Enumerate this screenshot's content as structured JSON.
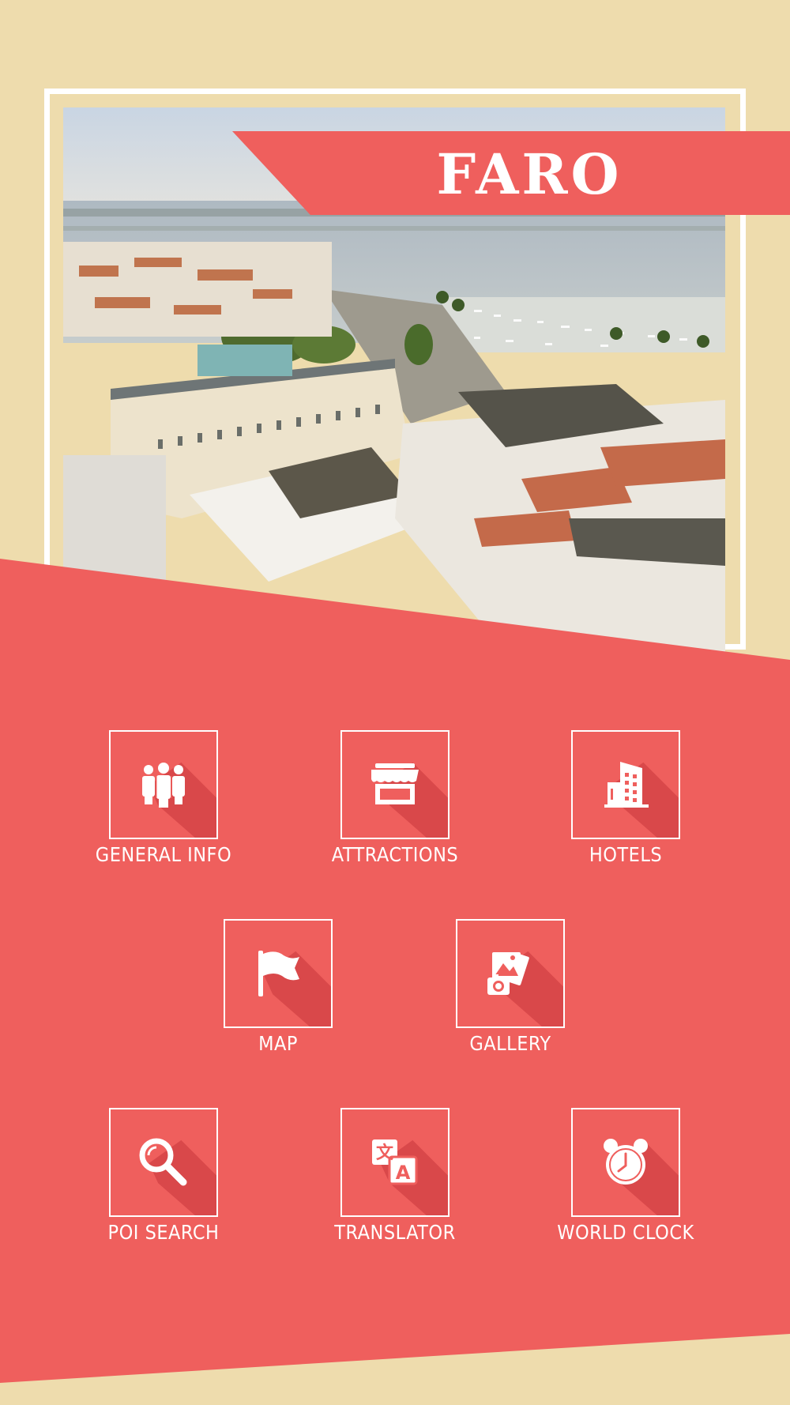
{
  "app": {
    "title": "FARO"
  },
  "colors": {
    "background": "#EEDCAD",
    "accent": "#EF5F5D",
    "accent_dark": "#D9484A",
    "text": "#FFFFFF"
  },
  "hero": {
    "image_icon": "city-harbor-photo"
  },
  "menu": [
    {
      "label": "GENERAL INFO",
      "icon": "people-icon"
    },
    {
      "label": "ATTRACTIONS",
      "icon": "store-icon"
    },
    {
      "label": "HOTELS",
      "icon": "building-icon"
    },
    {
      "label": "MAP",
      "icon": "flag-icon"
    },
    {
      "label": "GALLERY",
      "icon": "photos-icon"
    },
    {
      "label": "POI SEARCH",
      "icon": "search-icon"
    },
    {
      "label": "TRANSLATOR",
      "icon": "translate-icon"
    },
    {
      "label": "WORLD CLOCK",
      "icon": "alarm-clock-icon"
    }
  ]
}
